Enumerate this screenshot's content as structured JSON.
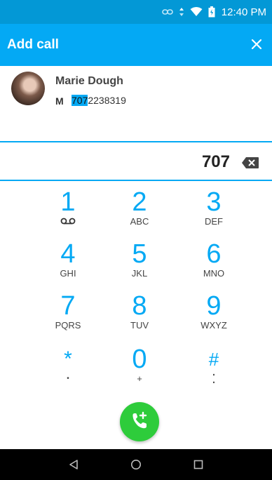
{
  "status_bar": {
    "time": "12:40 PM",
    "icons": [
      "link-icon",
      "data-arrows-icon",
      "wifi-icon",
      "battery-icon"
    ],
    "color": "#0398d6"
  },
  "app_bar": {
    "title": "Add call",
    "close_icon": "close-icon",
    "color": "#04a9f4"
  },
  "contact_suggestion": {
    "name": "Marie Dough",
    "number_type": "M",
    "number_match": "707",
    "number_rest": "2238319"
  },
  "dial_input": {
    "digits": "707",
    "backspace_icon": "backspace-icon"
  },
  "keypad": [
    {
      "digit": "1",
      "letters": "",
      "sub_icon": "voicemail-icon"
    },
    {
      "digit": "2",
      "letters": "ABC"
    },
    {
      "digit": "3",
      "letters": "DEF"
    },
    {
      "digit": "4",
      "letters": "GHI"
    },
    {
      "digit": "5",
      "letters": "JKL"
    },
    {
      "digit": "6",
      "letters": "MNO"
    },
    {
      "digit": "7",
      "letters": "PQRS"
    },
    {
      "digit": "8",
      "letters": "TUV"
    },
    {
      "digit": "9",
      "letters": "WXYZ"
    },
    {
      "digit": "*",
      "letters": "•"
    },
    {
      "digit": "0",
      "letters": "+"
    },
    {
      "digit": "#",
      "letters": "⁚"
    }
  ],
  "call_button": {
    "icon": "add-call-icon",
    "color": "#2ecc3b"
  },
  "nav_bar": {
    "icons": [
      "back-icon",
      "home-icon",
      "recents-icon"
    ]
  }
}
